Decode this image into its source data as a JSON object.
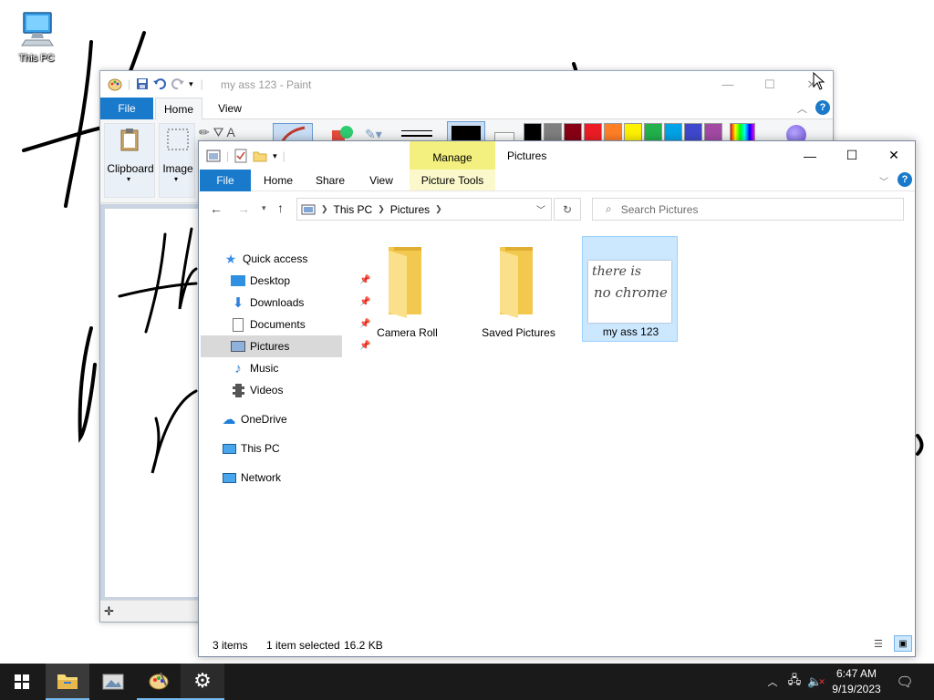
{
  "desktop": {
    "icon_label": "This PC"
  },
  "paint": {
    "title": "my ass 123 - Paint",
    "tabs": {
      "file": "File",
      "home": "Home",
      "view": "View"
    },
    "groups": {
      "clipboard": "Clipboard",
      "image": "Image"
    },
    "palette": [
      "#000000",
      "#7f7f7f",
      "#880015",
      "#ed1c24",
      "#ff7f27",
      "#fff200",
      "#22b14c",
      "#00a2e8",
      "#3f48cc",
      "#a349a4"
    ]
  },
  "explorer": {
    "title": "Pictures",
    "manage_label": "Manage",
    "ribbon_tabs": {
      "file": "File",
      "home": "Home",
      "share": "Share",
      "view": "View",
      "picture_tools": "Picture Tools"
    },
    "breadcrumb": {
      "root": "This PC",
      "current": "Pictures"
    },
    "search_placeholder": "Search Pictures",
    "nav": {
      "quick_access": "Quick access",
      "desktop": "Desktop",
      "downloads": "Downloads",
      "documents": "Documents",
      "pictures": "Pictures",
      "music": "Music",
      "videos": "Videos",
      "onedrive": "OneDrive",
      "this_pc": "This PC",
      "network": "Network"
    },
    "items": [
      {
        "name": "Camera Roll",
        "kind": "folder"
      },
      {
        "name": "Saved Pictures",
        "kind": "folder"
      },
      {
        "name": "my ass 123",
        "kind": "image",
        "thumb_text_1": "there is",
        "thumb_text_2": "no chrome"
      }
    ],
    "status": {
      "count": "3 items",
      "selected": "1 item selected",
      "size": "16.2 KB"
    }
  },
  "taskbar": {
    "time": "6:47 AM",
    "date": "9/19/2023"
  },
  "colors": {
    "accent": "#1979ca",
    "manage": "#f4f07f",
    "selection": "#cce8ff",
    "folder": "#f8d775",
    "taskbar": "#1a1a1a"
  }
}
